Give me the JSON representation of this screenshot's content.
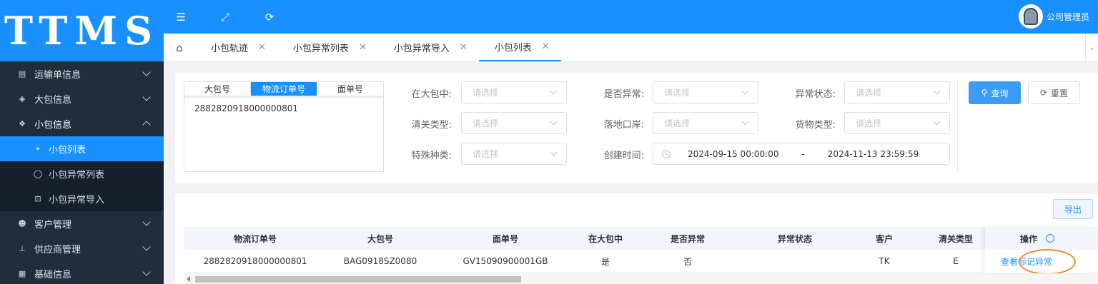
{
  "app": {
    "logo": "TTMS"
  },
  "user": {
    "name": "公司管理员"
  },
  "sidebar": {
    "items": [
      {
        "label": "运输单信息",
        "icon": "truck-icon"
      },
      {
        "label": "大包信息",
        "icon": "box-icon"
      },
      {
        "label": "小包信息",
        "icon": "package-icon"
      },
      {
        "label": "小包列表",
        "icon": "list-icon"
      },
      {
        "label": "小包异常列表",
        "icon": "bulb-icon"
      },
      {
        "label": "小包异常导入",
        "icon": "import-icon"
      },
      {
        "label": "客户管理",
        "icon": "user-icon"
      },
      {
        "label": "供应商管理",
        "icon": "network-icon"
      },
      {
        "label": "基础信息",
        "icon": "grid-icon"
      }
    ]
  },
  "tabs": [
    {
      "label": "小包轨迹"
    },
    {
      "label": "小包异常列表"
    },
    {
      "label": "小包异常导入"
    },
    {
      "label": "小包列表"
    }
  ],
  "search": {
    "segments": [
      "大包号",
      "物流订单号",
      "面单号"
    ],
    "active_segment": "物流订单号",
    "order_text": "2882820918000000801",
    "fields": {
      "in_bag": {
        "label": "在大包中:",
        "placeholder": "请选择"
      },
      "is_abnormal": {
        "label": "是否异常:",
        "placeholder": "请选择"
      },
      "abnormal_status": {
        "label": "异常状态:",
        "placeholder": "请选择"
      },
      "customs_type": {
        "label": "清关类型:",
        "placeholder": "请选择"
      },
      "landing_port": {
        "label": "落地口岸:",
        "placeholder": "请选择"
      },
      "goods_type": {
        "label": "货物类型:",
        "placeholder": "请选择"
      },
      "special_type": {
        "label": "特殊种类:",
        "placeholder": "请选择"
      },
      "create_time": {
        "label": "创建时间:",
        "start": "2024-09-15 00:00:00",
        "separator": "-",
        "end": "2024-11-13 23:59:59"
      }
    },
    "query_label": "查询",
    "reset_label": "重置"
  },
  "table": {
    "export_label": "导出",
    "columns": [
      "物流订单号",
      "大包号",
      "面单号",
      "在大包中",
      "是否异常",
      "异常状态",
      "客户",
      "清关类型",
      "操作"
    ],
    "rows": [
      {
        "order_no": "2882820918000000801",
        "bag_no": "BAG0918SZ0080",
        "waybill_no": "GV15090900001GB",
        "in_bag": "是",
        "is_abnormal": "否",
        "abnormal_status": "",
        "customer": "TK",
        "customs_type": "E"
      }
    ],
    "actions": {
      "view": "查看",
      "mark": "标记异常"
    }
  },
  "colors": {
    "primary": "#1890ff",
    "sidebar_bg": "#1f2d3d",
    "highlight_circle": "#f08a24"
  }
}
